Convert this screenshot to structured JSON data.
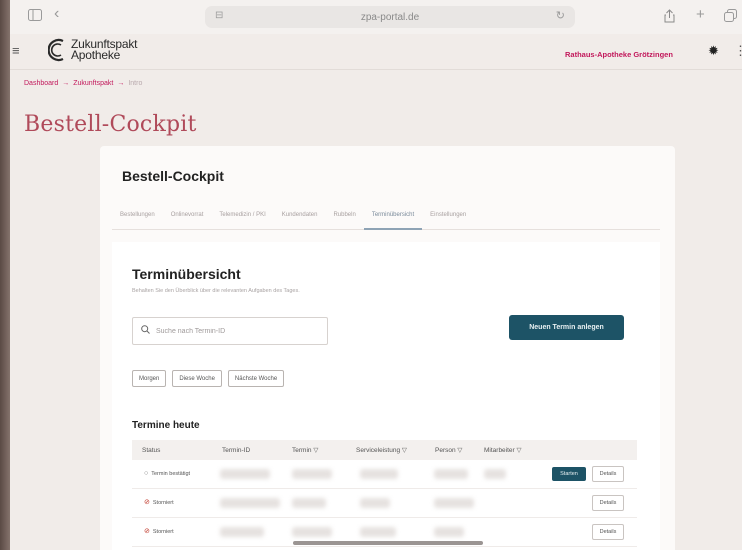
{
  "browser": {
    "url": "zpa-portal.de",
    "icons": {
      "sidebar": "sidebar-icon",
      "back": "back-arrow-icon",
      "lock": "lock-icon",
      "reload": "reload-icon",
      "share": "share-icon",
      "new_tab": "plus-icon",
      "tabs": "tabs-icon"
    }
  },
  "header": {
    "logo_line1": "Zukunftspakt",
    "logo_line2": "Apotheke",
    "pharmacy": "Rathaus-Apotheke Grötzingen",
    "accent_color": "#c2185b"
  },
  "breadcrumb": {
    "items": [
      "Dashboard",
      "Zukunftspakt",
      "Intro"
    ],
    "separator": "→"
  },
  "page_title": "Bestell-Cockpit",
  "card": {
    "title": "Bestell-Cockpit",
    "tabs": [
      {
        "label": "Bestellungen",
        "active": false
      },
      {
        "label": "Onlinevorrat",
        "active": false
      },
      {
        "label": "Telemedizin / PKI",
        "active": false
      },
      {
        "label": "Kundendaten",
        "active": false
      },
      {
        "label": "Rubbeln",
        "active": false
      },
      {
        "label": "Terminübersicht",
        "active": true
      },
      {
        "label": "Einstellungen",
        "active": false
      }
    ]
  },
  "overview": {
    "title": "Terminübersicht",
    "subtitle": "Behalten Sie den Überblick über die relevanten Aufgaben des Tages.",
    "search_placeholder": "Suche nach Termin-ID",
    "new_button": "Neuen Termin anlegen",
    "button_color": "#1d5366",
    "filters": [
      "Morgen",
      "Diese Woche",
      "Nächste Woche"
    ]
  },
  "today": {
    "title": "Termine heute",
    "columns": [
      "Status",
      "Termin-ID",
      "Termin",
      "Serviceleistung",
      "Person",
      "Mitarbeiter"
    ],
    "rows": [
      {
        "status": "Termin bestätigt",
        "status_type": "confirmed",
        "start": "Starten",
        "details": "Details"
      },
      {
        "status": "Storniert",
        "status_type": "cancelled",
        "start": "",
        "details": "Details"
      },
      {
        "status": "Storniert",
        "status_type": "cancelled",
        "start": "",
        "details": "Details"
      }
    ]
  }
}
